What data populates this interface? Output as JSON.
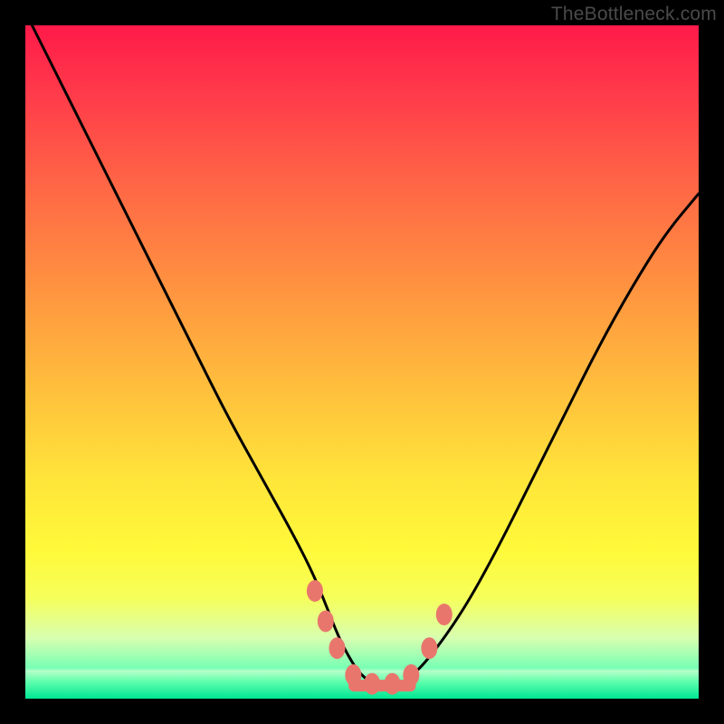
{
  "watermark": "TheBottleneck.com",
  "colors": {
    "frame": "#000000",
    "curve": "#000000",
    "marker": "#e9766d"
  },
  "chart_data": {
    "type": "line",
    "title": "",
    "xlabel": "",
    "ylabel": "",
    "xlim": [
      0,
      100
    ],
    "ylim": [
      0,
      100
    ],
    "grid": false,
    "legend": false,
    "note": "Values estimated from pixel positions; no axis tick labels visible.",
    "series": [
      {
        "name": "curve",
        "x": [
          1,
          5,
          10,
          15,
          20,
          25,
          30,
          35,
          40,
          43,
          45,
          47,
          50,
          53,
          55,
          57,
          60,
          65,
          70,
          75,
          80,
          85,
          90,
          95,
          100
        ],
        "y": [
          100,
          92,
          82,
          72,
          62,
          52,
          42,
          33,
          24,
          18,
          13,
          8,
          3,
          2,
          2,
          3,
          6,
          13,
          22,
          32,
          42,
          52,
          61,
          69,
          75
        ]
      }
    ],
    "markers": [
      {
        "x": 43.0,
        "y": 16.0
      },
      {
        "x": 44.6,
        "y": 11.5
      },
      {
        "x": 46.3,
        "y": 7.5
      },
      {
        "x": 48.7,
        "y": 3.5
      },
      {
        "x": 51.5,
        "y": 2.2
      },
      {
        "x": 54.5,
        "y": 2.2
      },
      {
        "x": 57.3,
        "y": 3.5
      },
      {
        "x": 60.0,
        "y": 7.5
      },
      {
        "x": 62.2,
        "y": 12.5
      }
    ],
    "bottom_bar": {
      "x0": 48.0,
      "x1": 58.0,
      "y": 2.0
    }
  }
}
